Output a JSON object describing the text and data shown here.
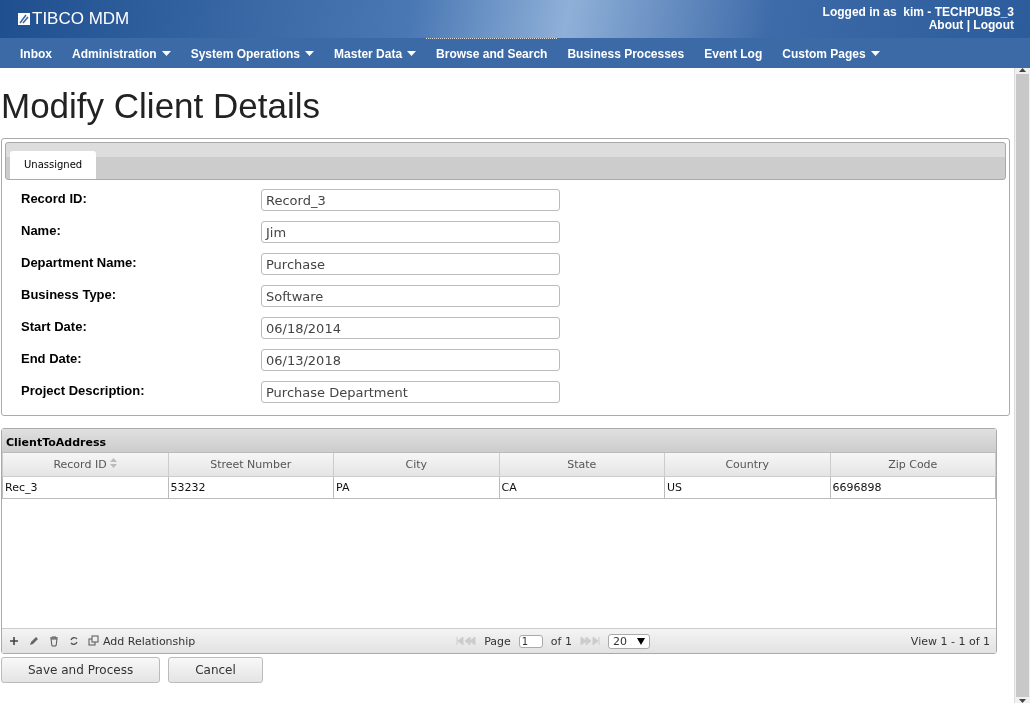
{
  "header": {
    "logo": "TIBCO MDM",
    "user_label": "Logged in as",
    "user": "kim - TECHPUBS_3",
    "links": [
      "About",
      "Logout"
    ],
    "link_separator": "|"
  },
  "nav": [
    {
      "label": "Inbox",
      "menu": false,
      "selected": false
    },
    {
      "label": "Administration",
      "menu": true,
      "selected": false
    },
    {
      "label": "System Operations",
      "menu": true,
      "selected": false
    },
    {
      "label": "Master Data",
      "menu": true,
      "selected": false
    },
    {
      "label": "Browse and Search",
      "menu": false,
      "selected": true
    },
    {
      "label": "Business Processes",
      "menu": false,
      "selected": false
    },
    {
      "label": "Event Log",
      "menu": false,
      "selected": false
    },
    {
      "label": "Custom Pages",
      "menu": true,
      "selected": false
    }
  ],
  "page_title": "Modify Client Details",
  "tabs": [
    {
      "label": "Unassigned",
      "selected": true
    }
  ],
  "fields": [
    {
      "label": "Record ID:",
      "value": "Record_3"
    },
    {
      "label": "Name:",
      "value": "Jim"
    },
    {
      "label": "Department Name:",
      "value": "Purchase"
    },
    {
      "label": "Business Type:",
      "value": "Software"
    },
    {
      "label": "Start Date:",
      "value": "06/18/2014"
    },
    {
      "label": "End Date:",
      "value": "06/13/2018"
    },
    {
      "label": "Project Description:",
      "value": "Purchase Department"
    }
  ],
  "grid": {
    "title": "ClientToAddress",
    "columns": [
      "Record ID",
      "Street Number",
      "City",
      "State",
      "Country",
      "Zip Code"
    ],
    "rows": [
      [
        "Rec_3",
        "53232",
        "PA",
        "CA",
        "US",
        "6696898"
      ]
    ],
    "add_relationship": "Add Relationship",
    "page_label": "Page",
    "page": "1",
    "of_pages": "of 1",
    "page_size": "20",
    "view": "View 1 - 1 of 1"
  },
  "buttons": [
    "Save and Process",
    "Cancel"
  ]
}
